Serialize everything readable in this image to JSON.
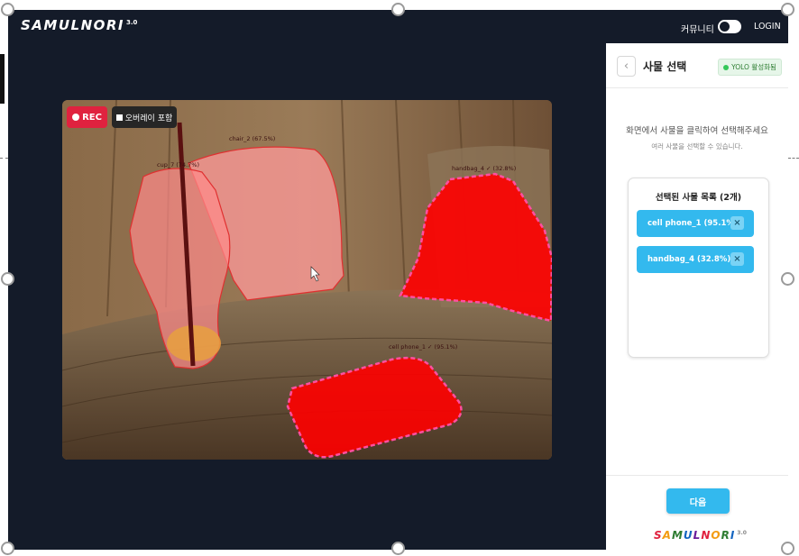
{
  "header": {
    "logo_text": "SAMULNORI",
    "logo_version": "3.0",
    "community_label": "커뮤니티",
    "login_label": "LOGIN"
  },
  "video": {
    "rec_label": "REC",
    "overlay_label": "오버레이 포함",
    "detections": [
      {
        "label": "cup_7 (74.7%)"
      },
      {
        "label": "chair_2 (67.5%)"
      },
      {
        "label": "handbag_4 ✓ (32.8%)"
      },
      {
        "label": "cell phone_1 ✓ (95.1%)"
      }
    ]
  },
  "panel": {
    "back_icon": "chevron-left-icon",
    "title": "사물 선택",
    "badge": "YOLO 활성화됨",
    "instruction": "화면에서 사물을 클릭하여 선택해주세요",
    "instruction_sub": "여러 사물을 선택할 수 있습니다.",
    "list_title": "선택된 사물 목록 (2개)",
    "selected": [
      {
        "label": "cell phone_1 (95.1%)"
      },
      {
        "label": "handbag_4 (32.8%)"
      }
    ],
    "next_label": "다음",
    "footer_logo": "SAMULNORI",
    "footer_version": "3.0"
  },
  "colors": {
    "accent": "#33b9ee",
    "rec": "#e0223f",
    "mask_red": "#ff0000",
    "dark_bg": "#141b29"
  }
}
